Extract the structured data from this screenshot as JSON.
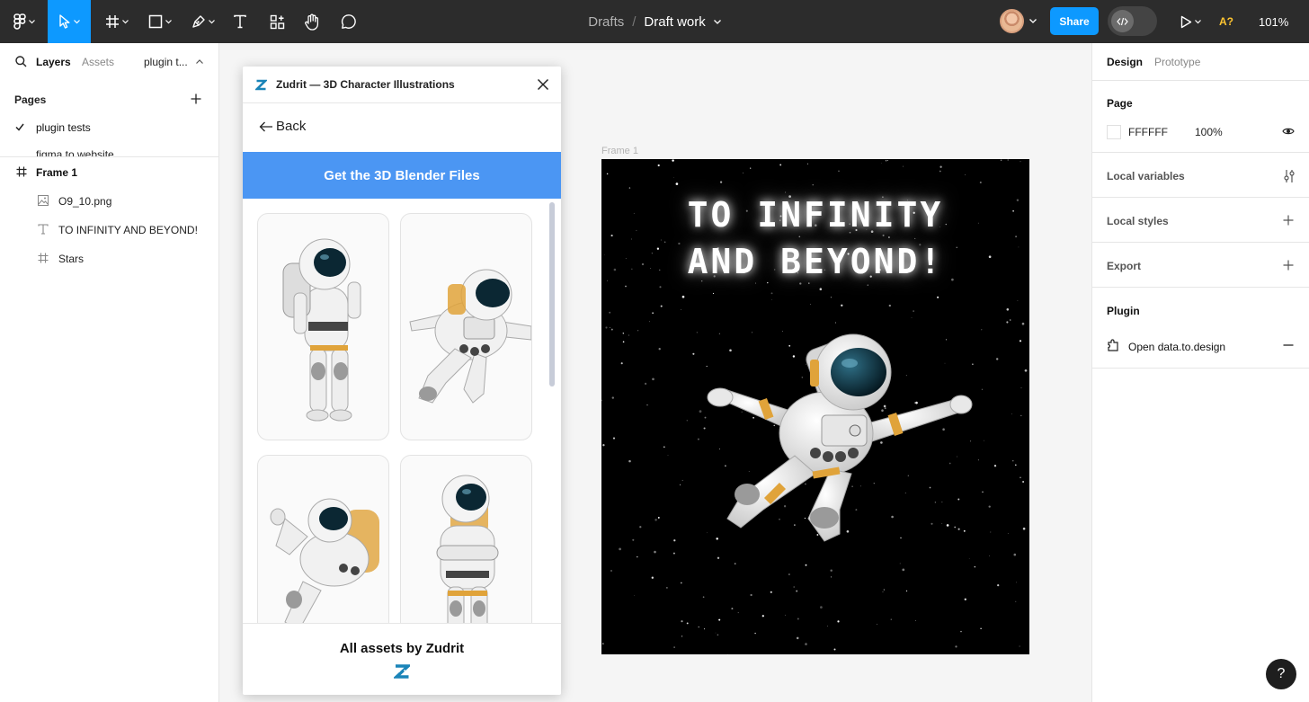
{
  "toolbar": {
    "breadcrumb_parent": "Drafts",
    "breadcrumb_sep": "/",
    "file_name": "Draft work",
    "share_label": "Share",
    "ai_badge": "A?",
    "zoom": "101%",
    "accent_color": "#0d99ff"
  },
  "left_panel": {
    "tabs": [
      "Layers",
      "Assets"
    ],
    "page_selector": "plugin t...",
    "pages_header": "Pages",
    "pages": [
      {
        "label": "plugin tests",
        "selected": true
      },
      {
        "label": "figma to website",
        "selected": false
      }
    ],
    "layers": [
      {
        "label": "Frame 1",
        "icon": "frame-icon",
        "bold": true
      },
      {
        "label": "O9_10.png",
        "icon": "image-icon"
      },
      {
        "label": "TO INFINITY AND BEYOND!",
        "icon": "text-icon"
      },
      {
        "label": "Stars",
        "icon": "frame-icon"
      }
    ]
  },
  "canvas": {
    "frame_label": "Frame 1",
    "frame_title_line1": "TO INFINITY",
    "frame_title_line2": "AND BEYOND!",
    "frame_background": "#000000"
  },
  "plugin": {
    "title": "Zudrit — 3D Character Illustrations",
    "back_label": "Back",
    "cta_label": "Get the 3D Blender Files",
    "cta_color": "#4b96f3",
    "footer_text": "All assets by Zudrit",
    "cards": [
      "astronaut-standing",
      "astronaut-flying",
      "astronaut-waving",
      "astronaut-arms-crossed"
    ]
  },
  "right_panel": {
    "tabs": [
      "Design",
      "Prototype"
    ],
    "page_header": "Page",
    "page_color": "FFFFFF",
    "page_opacity": "100%",
    "local_variables": "Local variables",
    "local_styles": "Local styles",
    "export": "Export",
    "plugin_header": "Plugin",
    "plugin_item": "Open data.to.design"
  },
  "help_label": "?"
}
